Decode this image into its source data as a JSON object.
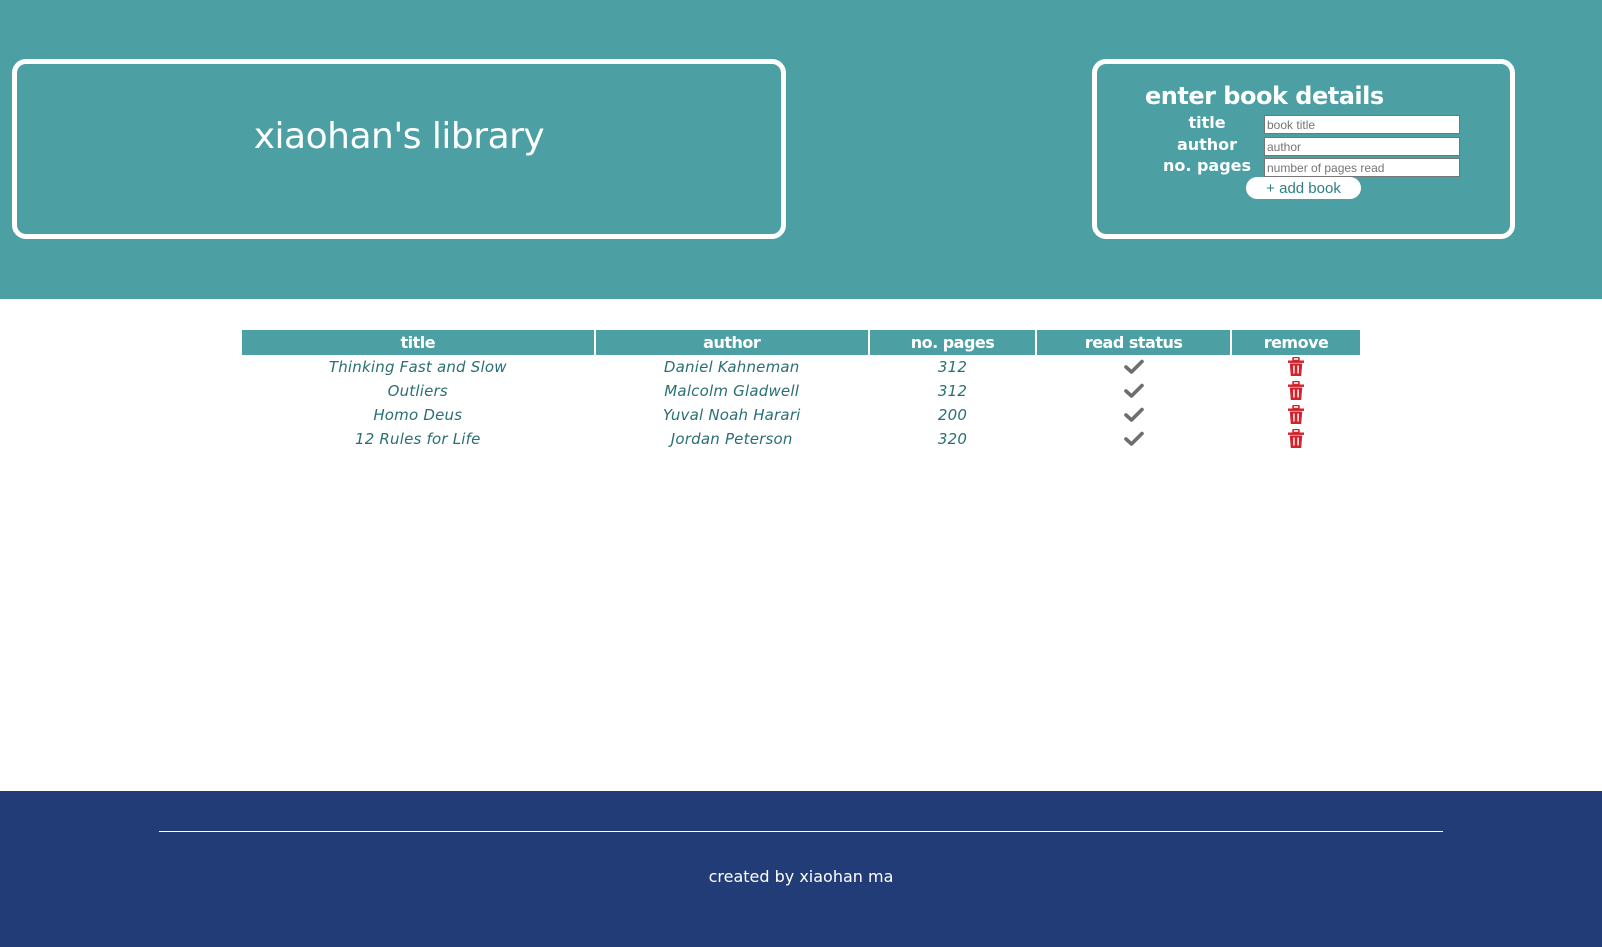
{
  "header": {
    "title": "xiaohan's library",
    "background": "#4ca0a3"
  },
  "form": {
    "heading": "enter book details",
    "fields": [
      {
        "label": "title",
        "placeholder": "book title"
      },
      {
        "label": "author",
        "placeholder": "author"
      },
      {
        "label": "no. pages",
        "placeholder": "number of pages read"
      }
    ],
    "submit_label": "+ add book"
  },
  "table": {
    "columns": [
      "title",
      "author",
      "no. pages",
      "read status",
      "remove"
    ],
    "rows": [
      {
        "title": "Thinking Fast and Slow",
        "author": "Daniel Kahneman",
        "pages": "312",
        "read_icon": "check-icon",
        "remove_icon": "trash-icon"
      },
      {
        "title": "Outliers",
        "author": "Malcolm Gladwell",
        "pages": "312",
        "read_icon": "check-icon",
        "remove_icon": "trash-icon"
      },
      {
        "title": "Homo Deus",
        "author": "Yuval Noah Harari",
        "pages": "200",
        "read_icon": "check-icon",
        "remove_icon": "trash-icon"
      },
      {
        "title": "12 Rules for Life",
        "author": "Jordan Peterson",
        "pages": "320",
        "read_icon": "check-icon",
        "remove_icon": "trash-icon"
      }
    ]
  },
  "footer": {
    "credit": "created by xiaohan ma",
    "background": "#223c77"
  },
  "colors": {
    "accent": "#4ca0a3",
    "check": "#6e6e6e",
    "trash": "#d2222d"
  }
}
